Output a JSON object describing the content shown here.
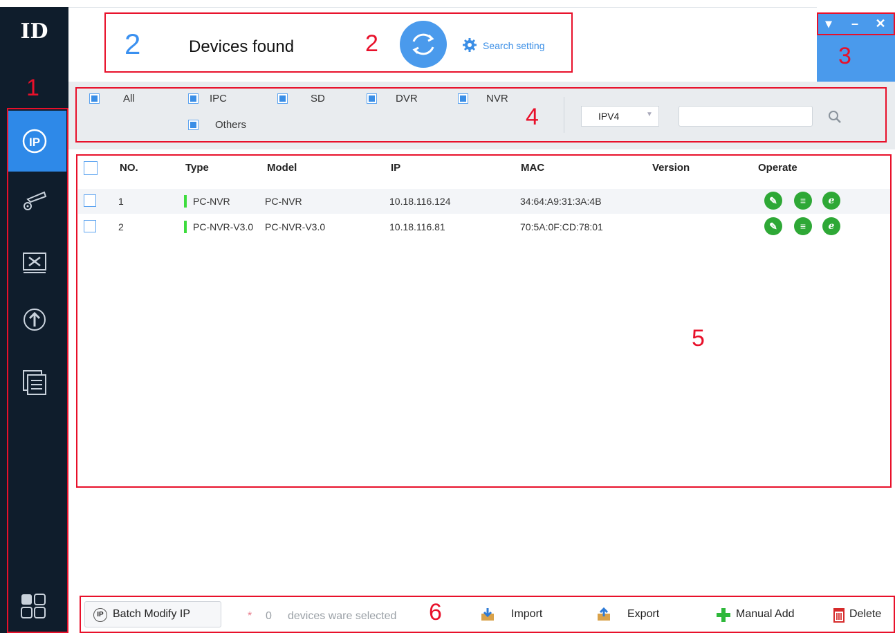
{
  "sidebar": {
    "logo": "ID",
    "items": [
      {
        "name": "ip-search-icon"
      },
      {
        "name": "device-config-icon"
      },
      {
        "name": "system-tools-icon"
      },
      {
        "name": "upgrade-icon"
      },
      {
        "name": "docs-icon"
      }
    ],
    "bottom_icon": "apps-grid-icon"
  },
  "header": {
    "found_count": "2",
    "found_label": "Devices found",
    "search_setting": "Search setting"
  },
  "annotations": {
    "n1": "1",
    "n2": "2",
    "n3": "3",
    "n4": "4",
    "n5": "5",
    "n6": "6"
  },
  "window_controls": {
    "menu": "▾",
    "minimize": "–",
    "close": "✕"
  },
  "filters": {
    "all": "All",
    "ipc": "IPC",
    "sd": "SD",
    "dvr": "DVR",
    "nvr": "NVR",
    "others": "Others",
    "ip_version": "IPV4",
    "search_value": ""
  },
  "table": {
    "headers": [
      "NO.",
      "Type",
      "Model",
      "IP",
      "MAC",
      "Version",
      "Operate"
    ],
    "rows": [
      {
        "no": "1",
        "type": "PC-NVR",
        "model": "PC-NVR",
        "ip": "10.18.116.124",
        "mac": "34:64:A9:31:3A:4B",
        "version": ""
      },
      {
        "no": "2",
        "type": "PC-NVR-V3.0",
        "model": "PC-NVR-V3.0",
        "ip": "10.18.116.81",
        "mac": "70:5A:0F:CD:78:01",
        "version": ""
      }
    ]
  },
  "bottom": {
    "batch_modify": "Batch Modify IP",
    "asterisk": "*",
    "selected_count": "0",
    "selected_label": "devices ware selected",
    "import": "Import",
    "export": "Export",
    "manual_add": "Manual Add",
    "delete": "Delete"
  },
  "colors": {
    "accent": "#2e89e8",
    "sidebar": "#0f1d2c",
    "annotation": "#e8102a",
    "status_online": "#3ddc3d",
    "op_button": "#2ea836"
  }
}
